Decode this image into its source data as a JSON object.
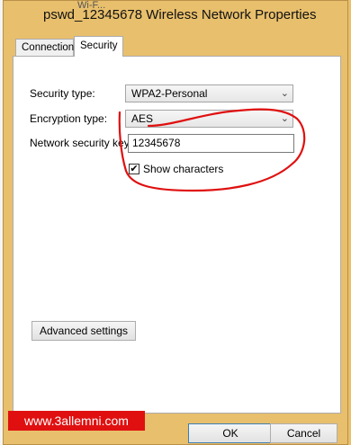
{
  "window": {
    "title": "pswd_12345678 Wireless Network Properties"
  },
  "background": {
    "fragment_text": "Wi-F..."
  },
  "tabs": [
    {
      "label": "Connection"
    },
    {
      "label": "Security"
    }
  ],
  "security": {
    "security_type_label": "Security type:",
    "security_type_value": "WPA2-Personal",
    "encryption_type_label": "Encryption type:",
    "encryption_type_value": "AES",
    "network_key_label": "Network security key",
    "network_key_value": "12345678",
    "show_characters_label": "Show characters",
    "show_characters_checked": true,
    "advanced_button": "Advanced settings"
  },
  "buttons": {
    "ok": "OK",
    "cancel": "Cancel"
  },
  "watermark": {
    "text": "www.3allemni.com"
  },
  "colors": {
    "frame": "#e8bf6c",
    "annotation": "#e01010",
    "watermark_bg": "#e01010"
  },
  "icons": {
    "dropdown": "chevron-down-icon",
    "check": "checkmark-icon"
  }
}
